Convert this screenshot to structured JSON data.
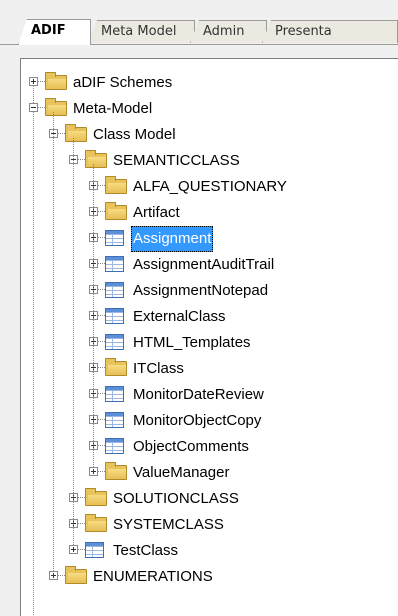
{
  "tabs": [
    {
      "label": "ADIF",
      "active": true
    },
    {
      "label": "Meta Model",
      "active": false
    },
    {
      "label": "Admin",
      "active": false
    },
    {
      "label": "Presenta",
      "active": false
    }
  ],
  "tree": {
    "nodes": [
      {
        "label": "aDIF Schemes",
        "icon": "folder-icon",
        "expanded": false,
        "selected": false
      },
      {
        "label": "Meta-Model",
        "icon": "folder-icon",
        "expanded": true,
        "selected": false
      },
      {
        "label": "Class Model",
        "icon": "folder-icon",
        "expanded": true,
        "selected": false
      },
      {
        "label": "SEMANTICCLASS",
        "icon": "folder-icon",
        "expanded": true,
        "selected": false
      },
      {
        "label": "ALFA_QUESTIONARY",
        "icon": "folder-icon",
        "expanded": false,
        "selected": false
      },
      {
        "label": "Artifact",
        "icon": "folder-icon",
        "expanded": false,
        "selected": false
      },
      {
        "label": "Assignment",
        "icon": "table-icon",
        "expanded": false,
        "selected": true
      },
      {
        "label": "AssignmentAuditTrail",
        "icon": "table-icon",
        "expanded": false,
        "selected": false
      },
      {
        "label": "AssignmentNotepad",
        "icon": "table-icon",
        "expanded": false,
        "selected": false
      },
      {
        "label": "ExternalClass",
        "icon": "table-icon",
        "expanded": false,
        "selected": false
      },
      {
        "label": "HTML_Templates",
        "icon": "table-icon",
        "expanded": false,
        "selected": false
      },
      {
        "label": "ITClass",
        "icon": "folder-icon",
        "expanded": false,
        "selected": false
      },
      {
        "label": "MonitorDateReview",
        "icon": "table-icon",
        "expanded": false,
        "selected": false
      },
      {
        "label": "MonitorObjectCopy",
        "icon": "table-icon",
        "expanded": false,
        "selected": false
      },
      {
        "label": "ObjectComments",
        "icon": "table-icon",
        "expanded": false,
        "selected": false
      },
      {
        "label": "ValueManager",
        "icon": "folder-icon",
        "expanded": false,
        "selected": false
      },
      {
        "label": "SOLUTIONCLASS",
        "icon": "folder-icon",
        "expanded": false,
        "selected": false
      },
      {
        "label": "SYSTEMCLASS",
        "icon": "folder-icon",
        "expanded": false,
        "selected": false
      },
      {
        "label": "TestClass",
        "icon": "table-icon",
        "expanded": false,
        "selected": false
      },
      {
        "label": "ENUMERATIONS",
        "icon": "folder-icon",
        "expanded": false,
        "selected": false
      }
    ]
  }
}
